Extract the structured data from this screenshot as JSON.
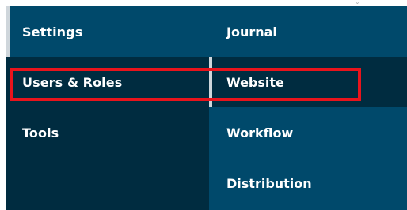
{
  "left_menu": {
    "items": [
      {
        "label": "Settings"
      },
      {
        "label": "Users & Roles"
      },
      {
        "label": "Tools"
      }
    ]
  },
  "submenu": {
    "items": [
      {
        "label": "Journal"
      },
      {
        "label": "Website"
      },
      {
        "label": "Workflow"
      },
      {
        "label": "Distribution"
      }
    ]
  },
  "colors": {
    "nav_dark": "#002c40",
    "nav_mid": "#00496b",
    "active_indicator": "#cfd6db",
    "highlight": "#e8141c"
  }
}
